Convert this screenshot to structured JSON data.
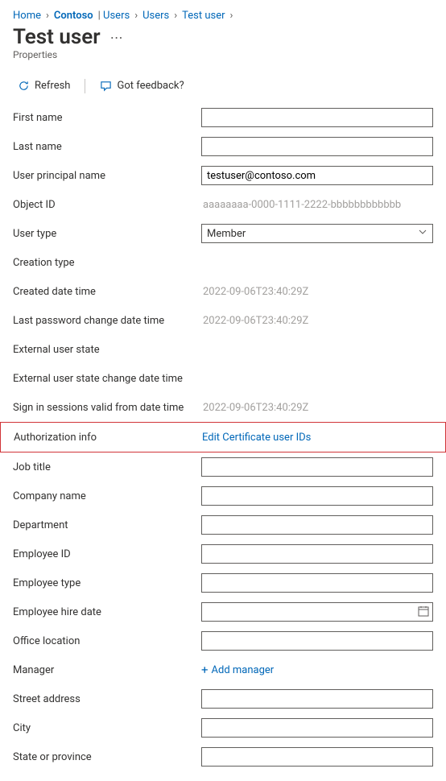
{
  "breadcrumb": {
    "items": [
      {
        "label": "Home"
      },
      {
        "label": "Contoso"
      },
      {
        "label": "Users",
        "prefix": "| "
      },
      {
        "label": "Users"
      },
      {
        "label": "Test user"
      }
    ]
  },
  "page": {
    "title": "Test user",
    "subtitle": "Properties"
  },
  "toolbar": {
    "refresh_label": "Refresh",
    "feedback_label": "Got feedback?"
  },
  "fields": {
    "first_name": {
      "label": "First name",
      "value": ""
    },
    "last_name": {
      "label": "Last name",
      "value": ""
    },
    "upn": {
      "label": "User principal name",
      "value": "testuser@contoso.com"
    },
    "object_id": {
      "label": "Object ID",
      "value": "aaaaaaaa-0000-1111-2222-bbbbbbbbbbbb"
    },
    "user_type": {
      "label": "User type",
      "value": "Member"
    },
    "creation_type": {
      "label": "Creation type",
      "value": ""
    },
    "created_date": {
      "label": "Created date time",
      "value": "2022-09-06T23:40:29Z"
    },
    "last_pwd_change": {
      "label": "Last password change date time",
      "value": "2022-09-06T23:40:29Z"
    },
    "ext_user_state": {
      "label": "External user state",
      "value": ""
    },
    "ext_user_state_change": {
      "label": "External user state change date time",
      "value": ""
    },
    "signin_valid_from": {
      "label": "Sign in sessions valid from date time",
      "value": "2022-09-06T23:40:29Z"
    },
    "auth_info": {
      "label": "Authorization info",
      "action": "Edit Certificate user IDs"
    },
    "job_title": {
      "label": "Job title",
      "value": ""
    },
    "company_name": {
      "label": "Company name",
      "value": ""
    },
    "department": {
      "label": "Department",
      "value": ""
    },
    "employee_id": {
      "label": "Employee ID",
      "value": ""
    },
    "employee_type": {
      "label": "Employee type",
      "value": ""
    },
    "employee_hire_date": {
      "label": "Employee hire date",
      "value": ""
    },
    "office_location": {
      "label": "Office location",
      "value": ""
    },
    "manager": {
      "label": "Manager",
      "action": "Add manager"
    },
    "street_address": {
      "label": "Street address",
      "value": ""
    },
    "city": {
      "label": "City",
      "value": ""
    },
    "state_province": {
      "label": "State or province",
      "value": ""
    }
  }
}
